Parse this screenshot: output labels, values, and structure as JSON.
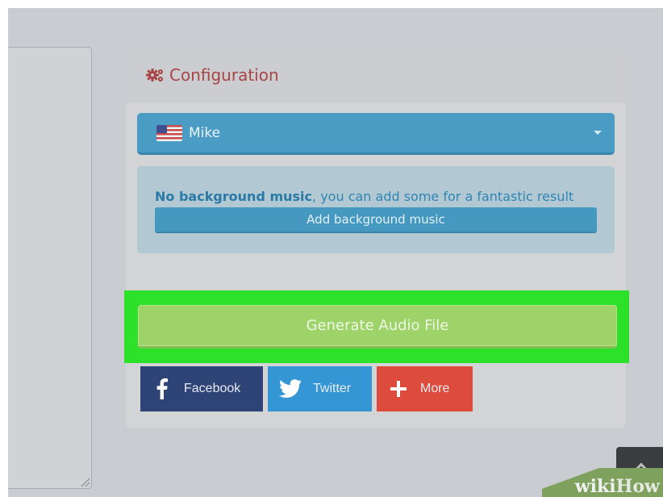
{
  "config": {
    "title": "Configuration",
    "accent_color": "#a94645",
    "icon": "gears-icon"
  },
  "voice": {
    "selected": "Mike",
    "flag": "us-flag-icon"
  },
  "music": {
    "status_bold": "No background music",
    "status_rest": ", you can add some for a fantastic result",
    "add_label": "Add background music"
  },
  "generate": {
    "label": "Generate Audio File",
    "color": "#9ed36a",
    "highlight_color": "#2de02a"
  },
  "share": {
    "facebook": "Facebook",
    "twitter": "Twitter",
    "more": "More"
  },
  "watermark": {
    "wiki": "wiki",
    "how": "How"
  }
}
